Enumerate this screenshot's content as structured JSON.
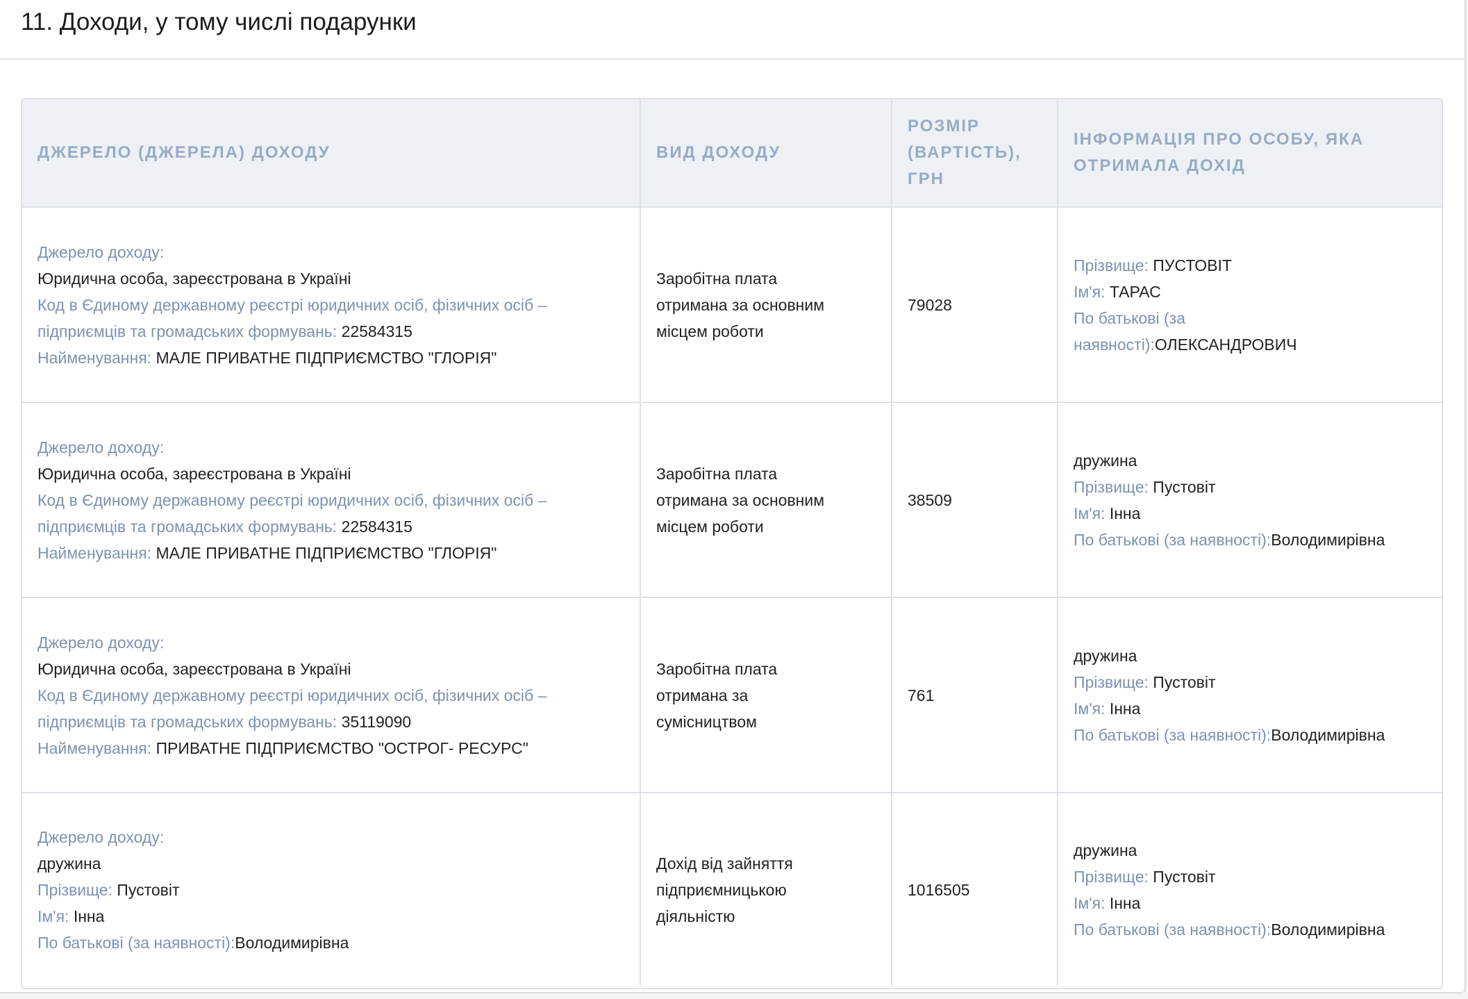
{
  "section": {
    "title": "11. Доходи, у тому числі подарунки"
  },
  "table": {
    "headers": {
      "source": "ДЖЕРЕЛО (ДЖЕРЕЛА) ДОХОДУ",
      "type": "ВИД ДОХОДУ",
      "amount_l1": "РОЗМІР",
      "amount_l2": "(ВАРТІСТЬ),",
      "amount_l3": "ГРН",
      "recipient_l1": "ІНФОРМАЦІЯ ПРО ОСОБУ, ЯКА",
      "recipient_l2": "ОТРИМАЛА ДОХІД"
    },
    "labels": {
      "source": "Джерело доходу:",
      "code_l1": "Код в Єдиному державному реєстрі юридичних осіб, фізичних осіб –",
      "code_l2": "підприємців та громадських формувань:",
      "name": "Найменування:",
      "surname": "Прізвище:",
      "first_name": "Ім'я:",
      "patronymic": "По батькові (за наявності):",
      "patronymic_l1": "По батькові (за",
      "patronymic_l2": "наявності):"
    },
    "rows": [
      {
        "source_kind": "Юридична особа, зареєстрована в Україні",
        "code": "22584315",
        "name": "МАЛЕ ПРИВАТНЕ ПІДПРИЄМСТВО \"ГЛОРІЯ\"",
        "type_l1": "Заробітна плата",
        "type_l2": "отримана за основним",
        "type_l3": "місцем роботи",
        "amount": "79028",
        "recipient_surname": "ПУСТОВІТ",
        "recipient_first_name": "ТАРАС",
        "recipient_patronymic": "ОЛЕКСАНДРОВИЧ"
      },
      {
        "source_kind": "Юридична особа, зареєстрована в Україні",
        "code": "22584315",
        "name": "МАЛЕ ПРИВАТНЕ ПІДПРИЄМСТВО \"ГЛОРІЯ\"",
        "type_l1": "Заробітна плата",
        "type_l2": "отримана за основним",
        "type_l3": "місцем роботи",
        "amount": "38509",
        "recipient_relation": "дружина",
        "recipient_surname": "Пустовіт",
        "recipient_first_name": "Інна",
        "recipient_patronymic": "Володимирівна"
      },
      {
        "source_kind": "Юридична особа, зареєстрована в Україні",
        "code": "35119090",
        "name": "ПРИВАТНЕ ПІДПРИЄМСТВО \"ОСТРОГ- РЕСУРС\"",
        "type_l1": "Заробітна плата",
        "type_l2": "отримана за",
        "type_l3": "сумісництвом",
        "amount": "761",
        "recipient_relation": "дружина",
        "recipient_surname": "Пустовіт",
        "recipient_first_name": "Інна",
        "recipient_patronymic": "Володимирівна"
      },
      {
        "source_relation": "дружина",
        "source_surname": "Пустовіт",
        "source_first_name": "Інна",
        "source_patronymic": "Володимирівна",
        "type_l1": "Дохід від зайняття",
        "type_l2": "підприємницькою",
        "type_l3": "діяльністю",
        "amount": "1016505",
        "recipient_relation": "дружина",
        "recipient_surname": "Пустовіт",
        "recipient_first_name": "Інна",
        "recipient_patronymic": "Володимирівна"
      }
    ]
  }
}
